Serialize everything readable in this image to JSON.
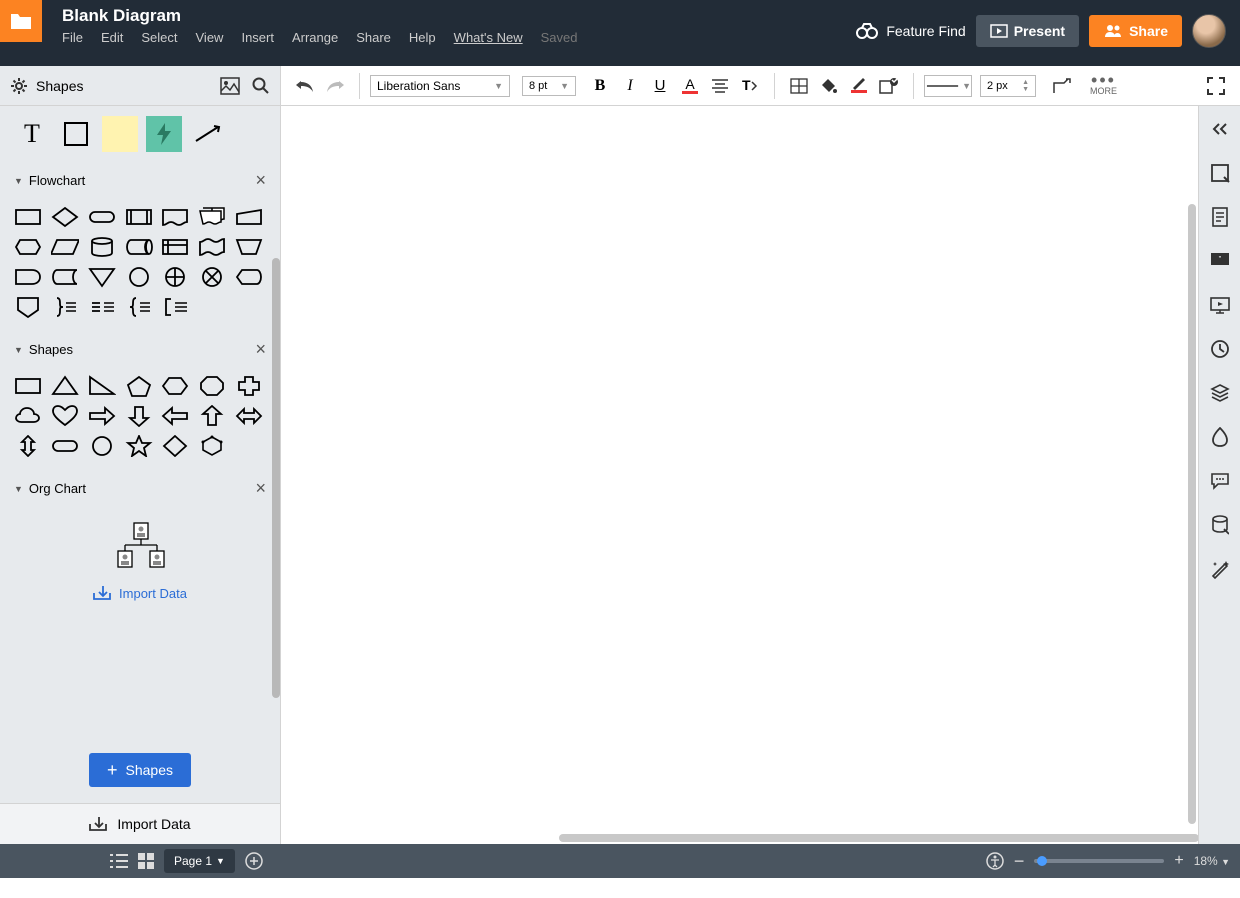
{
  "header": {
    "title": "Blank Diagram",
    "menu": [
      "File",
      "Edit",
      "Select",
      "View",
      "Insert",
      "Arrange",
      "Share",
      "Help"
    ],
    "whats_new": "What's New",
    "saved": "Saved",
    "feature_find": "Feature Find",
    "present": "Present",
    "share_btn": "Share"
  },
  "toolbar": {
    "shapes_label": "Shapes",
    "font": "Liberation Sans",
    "font_size": "8 pt",
    "line_width": "2 px",
    "more": "MORE"
  },
  "categories": {
    "flowchart": "Flowchart",
    "shapes": "Shapes",
    "org_chart": "Org Chart",
    "org_import": "Import Data"
  },
  "sidebar_footer": {
    "shapes_btn": "Shapes",
    "import_data": "Import Data"
  },
  "footer": {
    "page": "Page 1",
    "zoom": "18%"
  }
}
